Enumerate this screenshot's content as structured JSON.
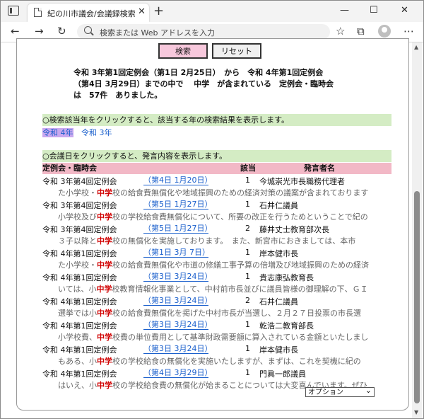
{
  "browser": {
    "tab_title": "紀の川市議会/会議録検索システム",
    "tab_close": "✕",
    "new_tab": "+",
    "address_placeholder": "検索または Web アドレスを入力",
    "win_min": "—",
    "win_max": "☐",
    "win_close": "✕"
  },
  "buttons": {
    "search": "検索",
    "reset": "リセット"
  },
  "summary": {
    "line1": "令和 3年第1回定例会（第1日 2月25日）　から　令和 4年第1回定例会",
    "line2": "（第4日 3月29日）までの中で　 中学　が含まれている　定例会・臨時会",
    "line3": "は　57件　ありました。"
  },
  "guide_year": "○検索該当年をクリックすると、該当する年の検索結果を表示します。",
  "years": [
    "令和 4年",
    "令和 3年"
  ],
  "guide_day": "○会議日をクリックすると、発言内容を表示します。",
  "table_header": {
    "session": "定例会・臨時会",
    "hit": "該当",
    "speaker": "発言者名"
  },
  "keyword": "中学",
  "rows": [
    {
      "session": "令和 3年第4回定例会",
      "date": "（第4日 1月20日）",
      "num": "1",
      "speaker": "今城崇光市長職務代理者",
      "pre": "た小学校・",
      "post": "校の給食費無償化や地域振興のための経済対策の議案が含まれております"
    },
    {
      "session": "令和 3年第4回定例会",
      "date": "（第5日 1月27日）",
      "num": "1",
      "speaker": "石井仁議員",
      "pre": "小学校及び",
      "post": "校の学校給食費無償化について、所要の改正を行うためということで紀の"
    },
    {
      "session": "令和 3年第4回定例会",
      "date": "（第5日 1月27日）",
      "num": "2",
      "speaker": "藤井丈士教育部次長",
      "pre": "３子以降と",
      "post": "校の無償化を実施しております。　また、新宮市におきましては、本市"
    },
    {
      "session": "令和 4年第1回定例会",
      "date": "（第1日 3月 7日）",
      "num": "1",
      "speaker": "岸本健市長",
      "pre": "た小学校・",
      "post": "校の給食費無償化や市道の修繕工事予算の倍増及び地域振興のための経済"
    },
    {
      "session": "令和 4年第1回定例会",
      "date": "（第3日 3月24日）",
      "num": "1",
      "speaker": "貴志康弘教育長",
      "pre": "いては、小",
      "post": "校教育情報化事業として、中村前市長並びに議員皆様の御理解の下、ＧＩ"
    },
    {
      "session": "令和 4年第1回定例会",
      "date": "（第3日 3月24日）",
      "num": "2",
      "speaker": "石井仁議員",
      "pre": "選挙では小",
      "post": "校の給食費無償化を掲げた中村市長が当選し、２月２７日投票の市長選"
    },
    {
      "session": "令和 4年第1回定例会",
      "date": "（第3日 3月24日）",
      "num": "1",
      "speaker": "乾浩二教育部長",
      "pre": "小学校費、",
      "post": "校費の単位費用として基準財政需要額に算入されている金額といたしまし"
    },
    {
      "session": "令和 4年第1回定例会",
      "date": "（第3日 3月24日）",
      "num": "1",
      "speaker": "岸本健市長",
      "pre": "もある、小",
      "post": "校の学校給食の無償化を実施いたしますが、まずは、これを契機に紀の"
    },
    {
      "session": "令和 4年第1回定例会",
      "date": "（第4日 3月29日）",
      "num": "1",
      "speaker": "門眞一郎議員",
      "pre": "はいえ、小",
      "post": "校の学校給食費の無償化が始まることについては大変喜んでいます。ぜひ"
    }
  ],
  "option_label": "オプション"
}
